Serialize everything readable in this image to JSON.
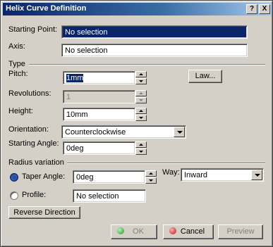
{
  "window": {
    "title": "Helix Curve Definition",
    "help_label": "?",
    "close_label": "X"
  },
  "starting_point": {
    "label": "Starting Point:",
    "value": "No selection"
  },
  "axis": {
    "label": "Axis:",
    "value": "No selection"
  },
  "type_group": {
    "label": "Type"
  },
  "pitch": {
    "label": "Pitch:",
    "value": "1mm",
    "law_button": "Law..."
  },
  "revolutions": {
    "label": "Revolutions:",
    "value": "1"
  },
  "height": {
    "label": "Height:",
    "value": "10mm"
  },
  "orientation": {
    "label": "Orientation:",
    "value": "Counterclockwise"
  },
  "starting_angle": {
    "label": "Starting Angle:",
    "value": "0deg"
  },
  "radius_group": {
    "label": "Radius variation"
  },
  "taper_angle": {
    "label": "Taper Angle:",
    "value": "0deg",
    "selected": true
  },
  "way": {
    "label": "Way:",
    "value": "Inward"
  },
  "profile": {
    "label": "Profile:",
    "value": "No selection",
    "selected": false
  },
  "reverse_button": "Reverse Direction",
  "footer": {
    "ok": "OK",
    "cancel": "Cancel",
    "preview": "Preview"
  },
  "colors": {
    "title_bar": "#0a246a",
    "selection": "#0a246a",
    "ok_dot": "#1f9a1f",
    "cancel_dot": "#c01010"
  }
}
